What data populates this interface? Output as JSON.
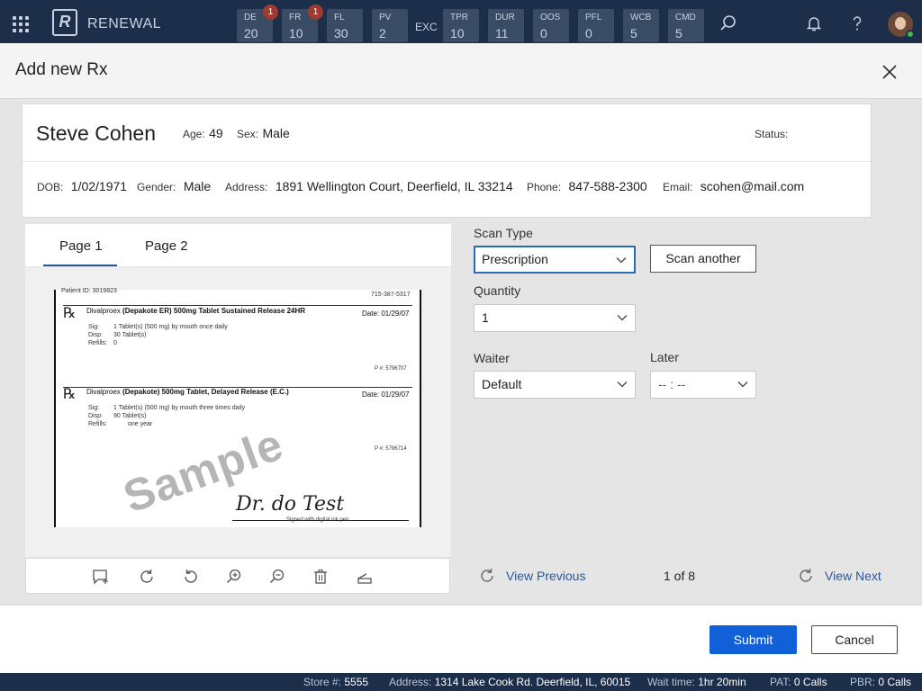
{
  "app": {
    "name": "RENEWAL",
    "logo_letter": "R"
  },
  "queues": [
    {
      "label": "DE",
      "value": "20",
      "badge": "1"
    },
    {
      "label": "FR",
      "value": "10",
      "badge": "1"
    },
    {
      "label": "FL",
      "value": "30"
    },
    {
      "label": "PV",
      "value": "2"
    },
    {
      "label": "TPR",
      "value": "10"
    },
    {
      "label": "DUR",
      "value": "11"
    },
    {
      "label": "OOS",
      "value": "0"
    },
    {
      "label": "PFL",
      "value": "0"
    },
    {
      "label": "WCB",
      "value": "5"
    },
    {
      "label": "CMD",
      "value": "5"
    }
  ],
  "exc_label": "EXC",
  "modal": {
    "title": "Add new Rx"
  },
  "patient": {
    "name": "Steve Cohen",
    "age_label": "Age:",
    "age": "49",
    "sex_label": "Sex:",
    "sex": "Male",
    "status_label": "Status:",
    "dob_label": "DOB:",
    "dob": "1/02/1971",
    "gender_label": "Gender:",
    "gender": "Male",
    "address_label": "Address:",
    "address": "1891 Wellington Court, Deerfield, IL 33214",
    "phone_label": "Phone:",
    "phone": "847-588-2300",
    "email_label": "Email:",
    "email": "scohen@mail.com"
  },
  "viewer": {
    "tabs": [
      "Page 1",
      "Page 2"
    ],
    "active_tab": "Page 1",
    "image": {
      "patient_id": "Patient ID: 3019823",
      "phone": "715-387-5317",
      "rx1": {
        "drug": "Divalproex",
        "drug_brand": "(Depakote ER)  500mg Tablet Sustained Release 24HR",
        "date": "Date: 01/29/07",
        "sig_label": "Sig:",
        "sig": "1 Tablet(s) (500 mg) by mouth once daily",
        "disp_label": "Disp:",
        "disp": "30 Tablet(s)",
        "refills_label": "Refills:",
        "refills": "0",
        "p_number": "P #: 5796707"
      },
      "rx2": {
        "drug": "Divalproex",
        "drug_brand": "(Depakote)  500mg Tablet, Delayed Release (E.C.)",
        "date": "Date: 01/29/07",
        "sig_label": "Sig:",
        "sig": "1 Tablet(s) (500 mg) by mouth three times daily",
        "disp_label": "Disp:",
        "disp": "90 Tablet(s)",
        "refills_label": "Refills:",
        "refills": "one year",
        "p_number": "P #: 5796714"
      },
      "watermark": "Sample",
      "signature": "Dr. do Test",
      "signature_caption": "Signed with digital ink pen"
    }
  },
  "form": {
    "scan_type_label": "Scan Type",
    "scan_type_value": "Prescription",
    "scan_another_label": "Scan another",
    "quantity_label": "Quantity",
    "quantity_value": "1",
    "waiter_label": "Waiter",
    "waiter_value": "Default",
    "later_label": "Later",
    "later_value": "-- :  --"
  },
  "pager": {
    "view_previous": "View Previous",
    "count": "1 of 8",
    "view_next": "View Next"
  },
  "actions": {
    "submit_label": "Submit",
    "cancel_label": "Cancel"
  },
  "statusbar": {
    "store_label": "Store #:",
    "store": "5555",
    "address_label": "Address:",
    "address": "1314 Lake Cook Rd. Deerfield, IL, 60015",
    "wait_label": "Wait time:",
    "wait": "1hr 20min",
    "pat_label": "PAT:",
    "pat": "0 Calls",
    "pbr_label": "PBR:",
    "pbr": "0 Calls"
  },
  "colors": {
    "topbar": "#1c2e4a",
    "accent": "#1160d8",
    "link": "#2b5797",
    "badge": "#9e3b2e"
  }
}
